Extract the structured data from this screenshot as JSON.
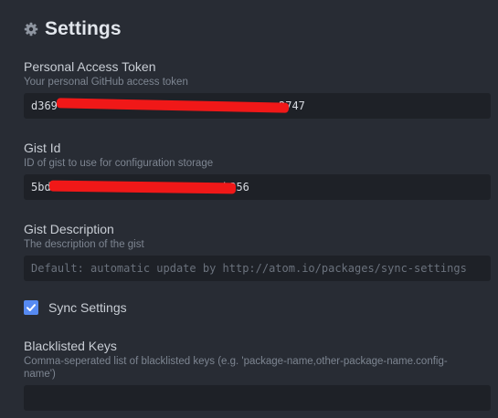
{
  "header": {
    "title": "Settings",
    "icon": "gear-icon"
  },
  "fields": {
    "token": {
      "label": "Personal Access Token",
      "description": "Your personal GitHub access token",
      "value_start": "d369",
      "value_end": "2747"
    },
    "gist_id": {
      "label": "Gist Id",
      "description": "ID of gist to use for configuration storage",
      "value_start": "5bd",
      "value_end": "b256"
    },
    "gist_description": {
      "label": "Gist Description",
      "description": "The description of the gist",
      "placeholder": "Default: automatic update by http://atom.io/packages/sync-settings"
    },
    "blacklisted_keys": {
      "label": "Blacklisted Keys",
      "description": "Comma-seperated list of blacklisted keys (e.g. 'package-name,other-package-name.config-name')",
      "value": ""
    }
  },
  "sync_settings": {
    "label": "Sync Settings",
    "checked": true
  },
  "colors": {
    "background": "#282c34",
    "input_background": "#1e2127",
    "accent": "#568af2",
    "redaction": "#f01818"
  }
}
